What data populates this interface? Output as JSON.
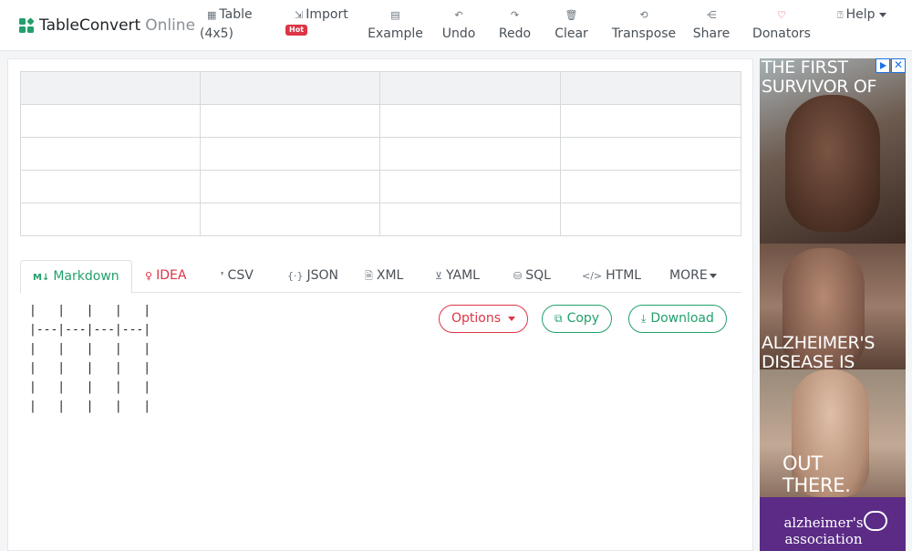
{
  "brand": {
    "name": "TableConvert",
    "sub": "Online"
  },
  "nav": {
    "table": {
      "label": "Table",
      "size": "(4x5)",
      "icon": "table-icon"
    },
    "import": {
      "label": "Import",
      "badge": "Hot",
      "icon": "import-icon"
    },
    "example": {
      "label": "Example",
      "icon": "example-icon"
    },
    "undo": {
      "label": "Undo",
      "icon": "undo-icon"
    },
    "redo": {
      "label": "Redo",
      "icon": "redo-icon"
    },
    "clear": {
      "label": "Clear",
      "icon": "trash-icon"
    },
    "transpose": {
      "label": "Transpose",
      "icon": "transpose-icon"
    },
    "share": {
      "label": "Share",
      "icon": "share-icon"
    },
    "donators": {
      "label": "Donators",
      "icon": "heart-icon"
    },
    "help": {
      "label": "Help",
      "icon": "help-icon"
    }
  },
  "grid": {
    "rows": 5,
    "cols": 4
  },
  "tabs": [
    {
      "label": "Markdown",
      "icon": "markdown-icon",
      "active": true
    },
    {
      "label": "IDEA",
      "icon": "lightbulb-icon"
    },
    {
      "label": "CSV",
      "icon": "csv-icon"
    },
    {
      "label": "JSON",
      "icon": "json-icon"
    },
    {
      "label": "XML",
      "icon": "xml-icon"
    },
    {
      "label": "YAML",
      "icon": "yaml-icon"
    },
    {
      "label": "SQL",
      "icon": "database-icon"
    },
    {
      "label": "HTML",
      "icon": "code-icon"
    },
    {
      "label": "MORE",
      "icon": "caret-down-icon"
    }
  ],
  "output": {
    "lines": [
      "|   |   |   |   |",
      "|---|---|---|---|",
      "|   |   |   |   |",
      "|   |   |   |   |",
      "|   |   |   |   |",
      "|   |   |   |   |"
    ]
  },
  "actions": {
    "options": "Options",
    "copy": "Copy",
    "download": "Download"
  },
  "ad": {
    "line1": "THE FIRST SURVIVOR OF",
    "line2": "ALZHEIMER'S DISEASE IS",
    "line3": "OUT THERE.",
    "brand": "alzheimer's association"
  },
  "colors": {
    "accent": "#22a06b",
    "danger": "#dc3545",
    "ad_brand": "#5b2b86"
  }
}
